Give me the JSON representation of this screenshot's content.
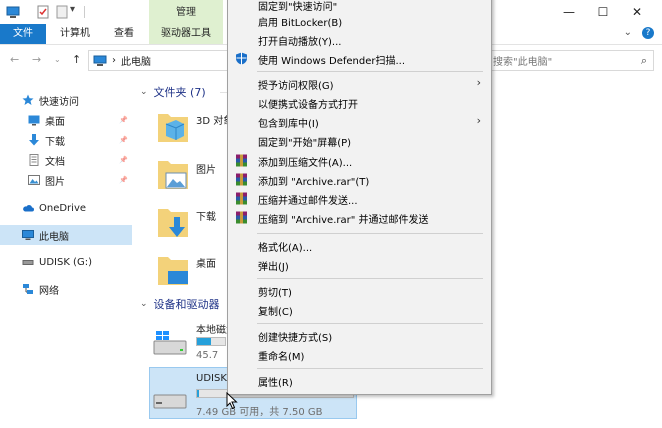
{
  "window": {
    "manage_tab": "管理",
    "minimize": "—",
    "maximize": "☐",
    "close": "✕"
  },
  "ribbon": {
    "tabs": [
      "文件",
      "计算机",
      "查看",
      "驱动器工具"
    ]
  },
  "address": {
    "separator": "›",
    "location": "此电脑",
    "search_placeholder": "搜索\"此电脑\""
  },
  "nav": {
    "items": [
      {
        "label": "快速访问",
        "icon": "star-icon"
      },
      {
        "label": "桌面",
        "icon": "desktop-icon"
      },
      {
        "label": "下载",
        "icon": "download-icon"
      },
      {
        "label": "文档",
        "icon": "document-icon"
      },
      {
        "label": "图片",
        "icon": "pictures-icon"
      },
      {
        "label": "OneDrive",
        "icon": "cloud-icon"
      },
      {
        "label": "此电脑",
        "icon": "computer-icon"
      },
      {
        "label": "UDISK (G:)",
        "icon": "usb-drive-icon"
      },
      {
        "label": "网络",
        "icon": "network-icon"
      }
    ],
    "pin_glyph": "📌"
  },
  "content": {
    "folders_header": "文件夹 (7)",
    "folders": [
      {
        "name": "3D 对象"
      },
      {
        "name": "图片"
      },
      {
        "name": "下载"
      },
      {
        "name": "桌面"
      }
    ],
    "devices_header": "设备和驱动器",
    "drives": [
      {
        "name": "本地磁盘 (C:)",
        "info": "45.7",
        "used_fraction": 0.5
      },
      {
        "name": "UDISK (G:)",
        "info": "7.49 GB 可用，共 7.50 GB",
        "used_fraction": 0.01
      }
    ]
  },
  "context_menu": {
    "items": [
      {
        "label": "固定到\"快速访问\"",
        "icon": ""
      },
      {
        "label": "启用 BitLocker(B)",
        "icon": ""
      },
      {
        "label": "打开自动播放(Y)...",
        "icon": ""
      },
      {
        "label": "使用 Windows Defender扫描...",
        "icon": "defender-shield-icon"
      },
      {
        "label": "授予访问权限(G)",
        "icon": "",
        "submenu": true
      },
      {
        "label": "以便携式设备方式打开",
        "icon": ""
      },
      {
        "label": "包含到库中(I)",
        "icon": "",
        "submenu": true
      },
      {
        "label": "固定到\"开始\"屏幕(P)",
        "icon": ""
      },
      {
        "label": "添加到压缩文件(A)...",
        "icon": "winrar-icon"
      },
      {
        "label": "添加到 \"Archive.rar\"(T)",
        "icon": "winrar-icon"
      },
      {
        "label": "压缩并通过邮件发送...",
        "icon": "winrar-icon"
      },
      {
        "label": "压缩到 \"Archive.rar\" 并通过邮件发送",
        "icon": "winrar-icon"
      },
      {
        "label": "格式化(A)...",
        "icon": ""
      },
      {
        "label": "弹出(J)",
        "icon": ""
      },
      {
        "label": "剪切(T)",
        "icon": ""
      },
      {
        "label": "复制(C)",
        "icon": ""
      },
      {
        "label": "创建快捷方式(S)",
        "icon": ""
      },
      {
        "label": "重命名(M)",
        "icon": ""
      },
      {
        "label": "属性(R)",
        "icon": ""
      }
    ],
    "submenu_arrow": "›"
  }
}
